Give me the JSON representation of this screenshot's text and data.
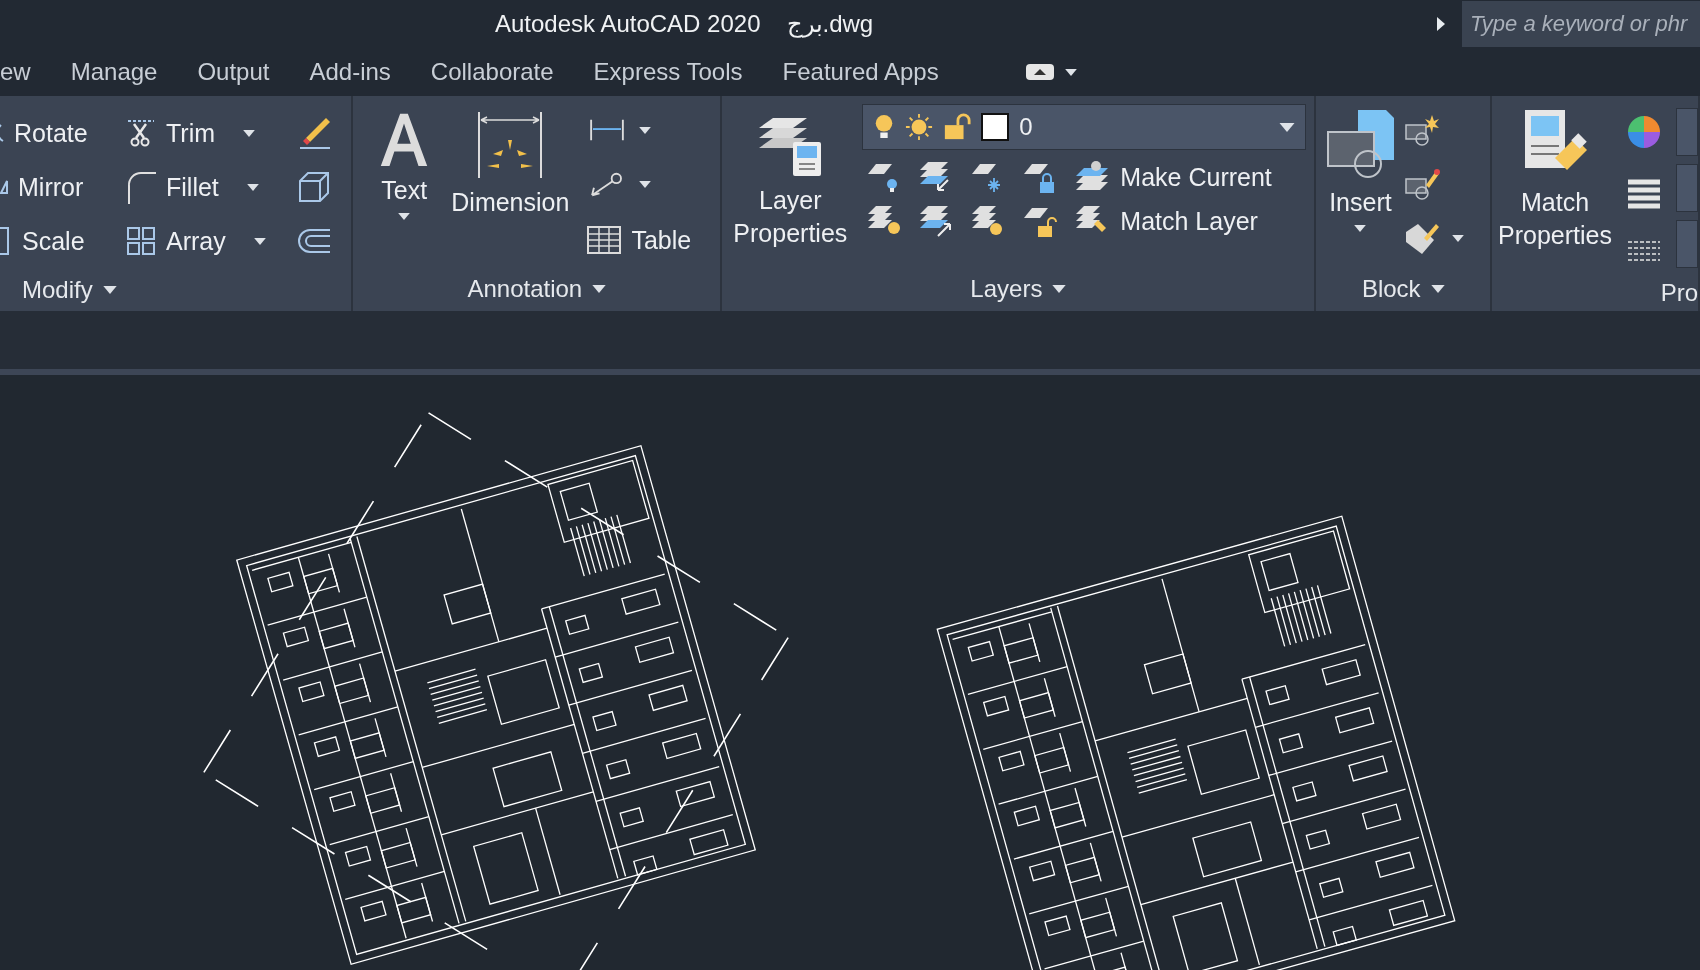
{
  "window": {
    "app_title": "Autodesk AutoCAD 2020",
    "file_name": "برج.dwg"
  },
  "search": {
    "placeholder": "Type a keyword or phr"
  },
  "menu_tabs": [
    {
      "label": "ew",
      "selected": false
    },
    {
      "label": "Manage",
      "selected": false
    },
    {
      "label": "Output",
      "selected": false
    },
    {
      "label": "Add-ins",
      "selected": false
    },
    {
      "label": "Collaborate",
      "selected": false
    },
    {
      "label": "Express Tools",
      "selected": false
    },
    {
      "label": "Featured Apps",
      "selected": false
    }
  ],
  "ribbon": {
    "modify": {
      "title": "Modify",
      "tools": [
        {
          "label": "Rotate",
          "dropdown": false
        },
        {
          "label": "Trim",
          "dropdown": true
        },
        {
          "label": "Mirror",
          "dropdown": false
        },
        {
          "label": "Fillet",
          "dropdown": true
        },
        {
          "label": "Scale",
          "dropdown": false
        },
        {
          "label": "Array",
          "dropdown": true
        }
      ]
    },
    "annotation": {
      "title": "Annotation",
      "text_button": "Text",
      "dimension_button": "Dimension",
      "table_button": "Table"
    },
    "layers": {
      "title": "Layers",
      "properties_button": "Layer Properties",
      "current_layer": "0",
      "make_current": "Make Current",
      "match_layer": "Match Layer"
    },
    "block": {
      "title": "Block",
      "insert_button": "Insert"
    },
    "properties": {
      "title": "Pro",
      "match_properties": "Match Properties"
    }
  }
}
